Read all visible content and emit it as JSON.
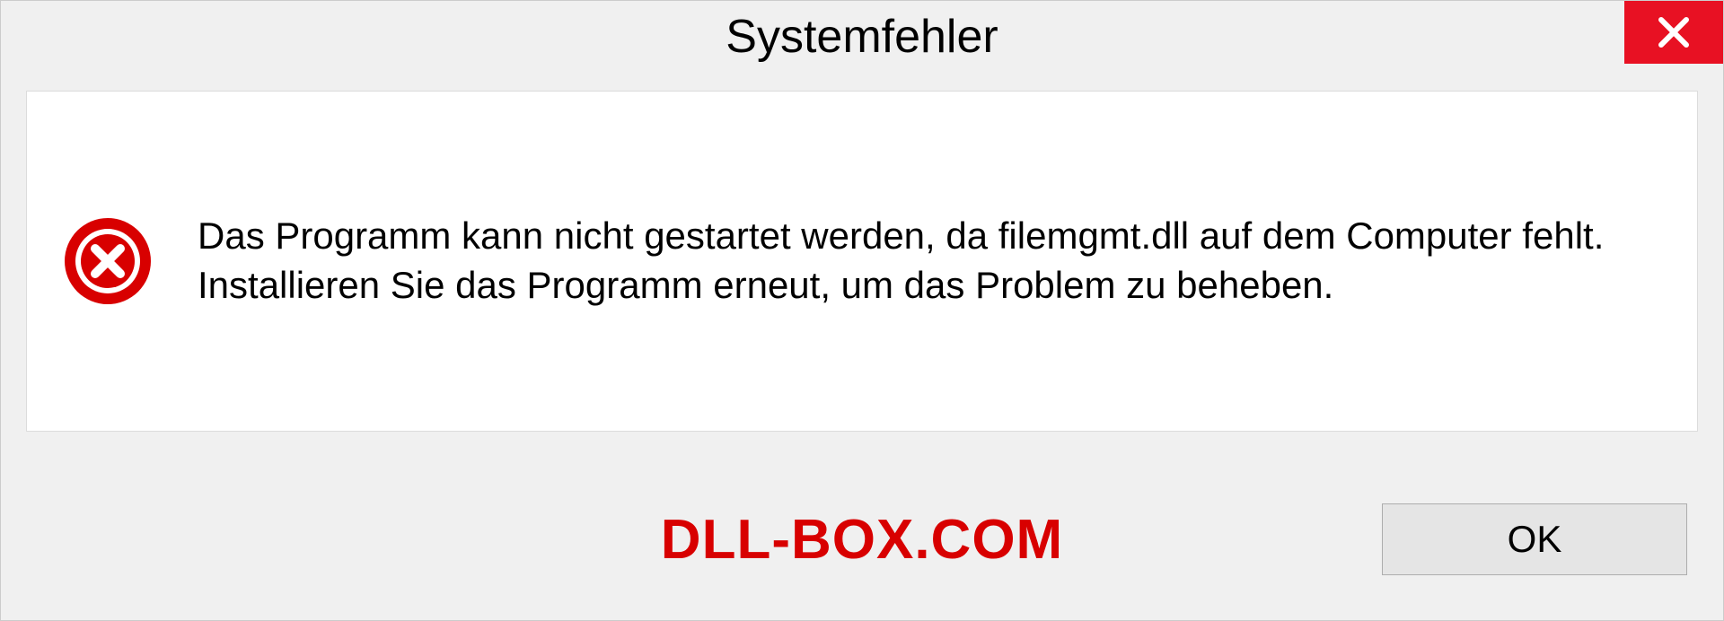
{
  "dialog": {
    "title": "Systemfehler",
    "message": "Das Programm kann nicht gestartet werden, da filemgmt.dll auf dem Computer fehlt. Installieren Sie das Programm erneut, um das Problem zu beheben.",
    "ok_label": "OK"
  },
  "watermark": "DLL-BOX.COM"
}
